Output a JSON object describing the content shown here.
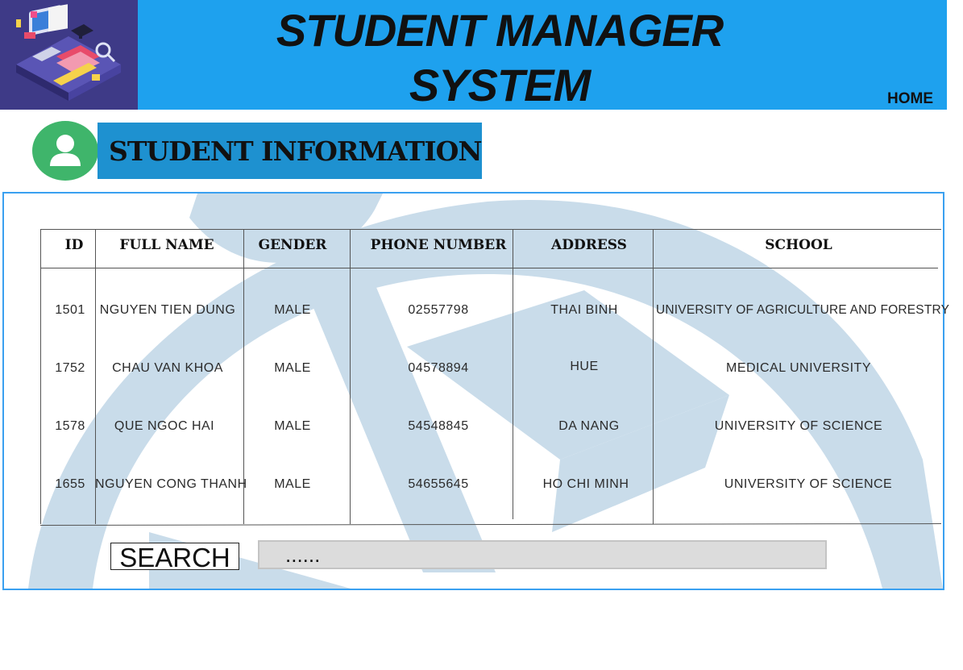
{
  "header": {
    "title_line1": "STUDENT MANAGER",
    "title_line2": "SYSTEM",
    "home_label": "HOME",
    "logo_icon": "study-desk-illustration-icon"
  },
  "section": {
    "icon": "user-icon",
    "title": "STUDENT INFORMATION"
  },
  "table": {
    "columns": [
      "ID",
      "FULL NAME",
      "GENDER",
      "PHONE NUMBER",
      "ADDRESS",
      "SCHOOL"
    ],
    "rows": [
      [
        "1501",
        "NGUYEN TIEN DUNG",
        "MALE",
        "02557798",
        "THAI BINH",
        "UNIVERSITY OF AGRICULTURE AND FORESTRY"
      ],
      [
        "1752",
        "CHAU VAN KHOA",
        "MALE",
        "04578894",
        "HUE",
        "MEDICAL UNIVERSITY"
      ],
      [
        "1578",
        "QUE NGOC HAI",
        "MALE",
        "54548845",
        "DA NANG",
        "UNIVERSITY OF SCIENCE"
      ],
      [
        "1655",
        "NGUYEN CONG THANH",
        "MALE",
        "54655645",
        "HO CHI MINH",
        "UNIVERSITY OF SCIENCE"
      ]
    ]
  },
  "search": {
    "button_label": "SEARCH",
    "input_value": "......"
  },
  "colors": {
    "header_bg": "#1ea1ee",
    "logo_bg": "#3e3a87",
    "section_bg": "#1e91d0",
    "user_badge": "#3fb56b",
    "panel_border": "#3aa0f0",
    "watermark": "#c9dcea"
  }
}
